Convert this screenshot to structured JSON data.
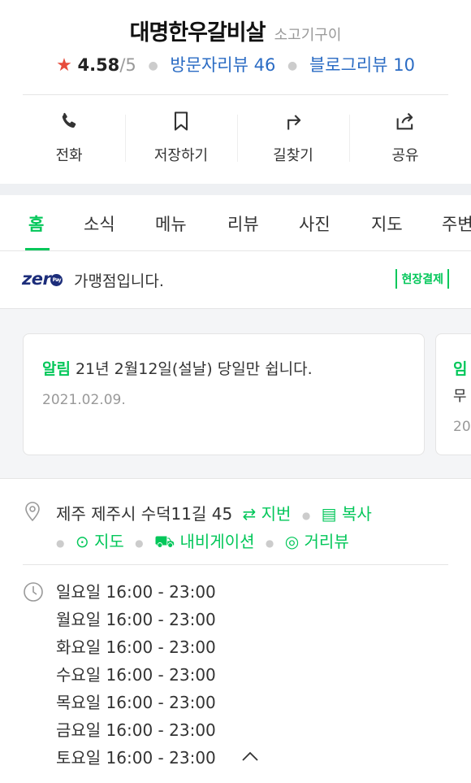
{
  "place": {
    "name": "대명한우갈비살",
    "category": "소고기구이",
    "rating": "4.58",
    "rating_max": "/5",
    "visitor_reviews": "방문자리뷰 46",
    "blog_reviews": "블로그리뷰 10"
  },
  "actions": [
    {
      "label": "전화",
      "icon": "phone-icon"
    },
    {
      "label": "저장하기",
      "icon": "bookmark-icon"
    },
    {
      "label": "길찾기",
      "icon": "directions-icon"
    },
    {
      "label": "공유",
      "icon": "share-icon"
    }
  ],
  "tabs": [
    "홈",
    "소식",
    "메뉴",
    "리뷰",
    "사진",
    "지도",
    "주변"
  ],
  "active_tab": "홈",
  "zeropay": {
    "logo": "zer",
    "logo_badge": "Pay",
    "text": "가맹점입니다.",
    "badge": "현장결제"
  },
  "notices": [
    {
      "tag": "알림",
      "text": "21년 2월12일(설날) 당일만 쉽니다.",
      "date": "2021.02.09."
    },
    {
      "tag": "임",
      "text": "무",
      "date": "20"
    }
  ],
  "address": {
    "text": "제주 제주시 수덕11길 45",
    "jibun": "지번",
    "copy": "복사",
    "map": "지도",
    "navigation": "내비게이션",
    "street_view": "거리뷰"
  },
  "hours": [
    "일요일 16:00 - 23:00",
    "월요일 16:00 - 23:00",
    "화요일 16:00 - 23:00",
    "수요일 16:00 - 23:00",
    "목요일 16:00 - 23:00",
    "금요일 16:00 - 23:00",
    "토요일 16:00 - 23:00"
  ],
  "colors": {
    "accent_green": "#03c75a",
    "link_blue": "#2b6cc4",
    "star_red": "#e74c3c",
    "zeropay_navy": "#1c2d7a"
  }
}
